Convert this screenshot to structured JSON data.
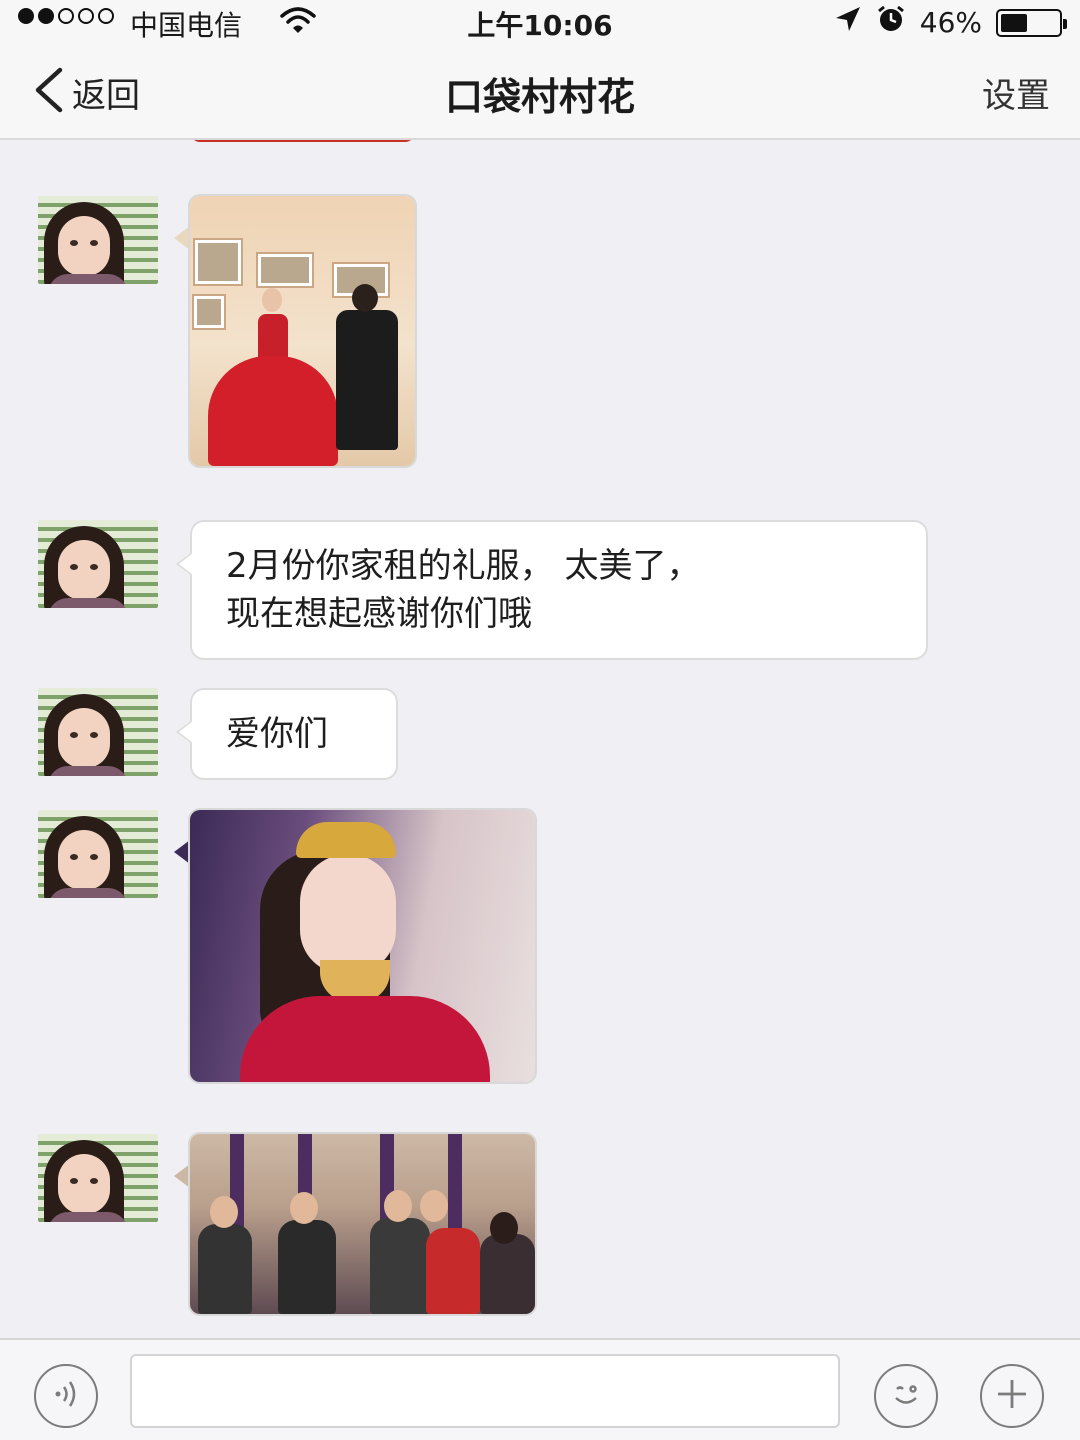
{
  "status_bar": {
    "carrier": "中国电信",
    "time": "上午10:06",
    "battery": "46%",
    "battery_level": 0.46,
    "signal_bars_filled": 2,
    "signal_bars_total": 5
  },
  "nav": {
    "back_label": "返回",
    "title": "口袋村村花",
    "settings_label": "设置"
  },
  "messages": [
    {
      "type": "image",
      "description_icon": "photo-icon"
    },
    {
      "type": "text",
      "lines": [
        "2月份你家租的礼服， 太美了，",
        "现在想起感谢你们哦"
      ]
    },
    {
      "type": "text",
      "lines": [
        "爱你们"
      ]
    },
    {
      "type": "image",
      "description_icon": "photo-icon"
    },
    {
      "type": "image",
      "description_icon": "photo-icon"
    }
  ],
  "input_bar": {
    "voice_icon": "voice-icon",
    "emoji_icon": "emoji-icon",
    "plus_icon": "plus-icon",
    "placeholder": ""
  },
  "colors": {
    "background": "#f0eff4",
    "bubble": "#ffffff",
    "bar": "#f7f7f7"
  }
}
